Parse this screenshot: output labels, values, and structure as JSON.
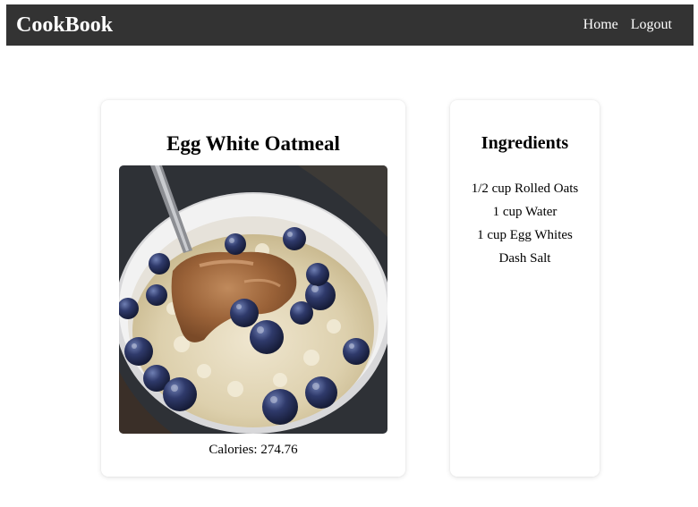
{
  "navbar": {
    "brand": "CookBook",
    "links": [
      "Home",
      "Logout"
    ]
  },
  "recipe": {
    "title": "Egg White Oatmeal",
    "calories_label": "Calories: 274.76"
  },
  "ingredients": {
    "title": "Ingredients",
    "items": [
      "1/2 cup Rolled Oats",
      "1 cup Water",
      "1 cup Egg Whites",
      "Dash Salt"
    ]
  },
  "colors": {
    "navbar_bg": "#333333",
    "navbar_text": "#ffffff"
  }
}
